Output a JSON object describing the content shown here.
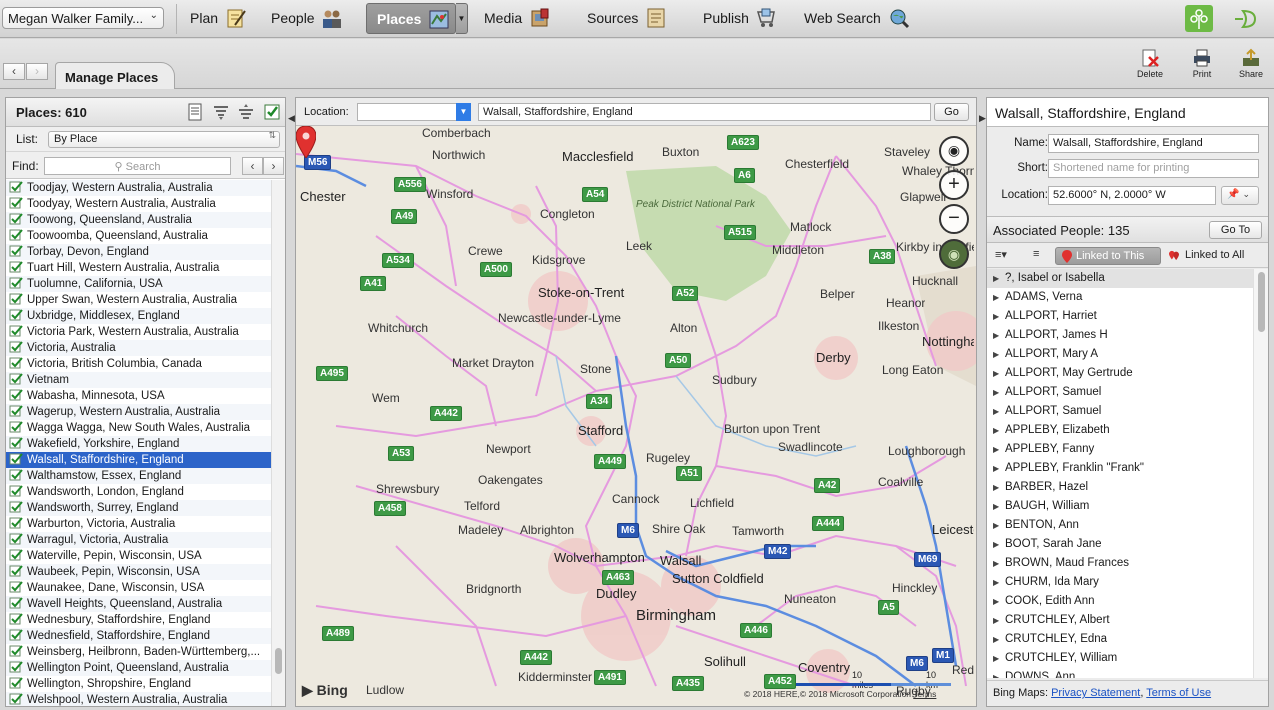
{
  "toolbar": {
    "family_file": "Megan Walker Family...",
    "nav": [
      {
        "id": "plan",
        "label": "Plan"
      },
      {
        "id": "people",
        "label": "People"
      },
      {
        "id": "places",
        "label": "Places"
      },
      {
        "id": "media",
        "label": "Media"
      },
      {
        "id": "sources",
        "label": "Sources"
      },
      {
        "id": "publish",
        "label": "Publish"
      },
      {
        "id": "web-search",
        "label": "Web Search"
      }
    ]
  },
  "subbar": {
    "tab": "Manage Places",
    "actions": {
      "delete": "Delete",
      "print": "Print",
      "share": "Share"
    }
  },
  "left": {
    "title": "Places: 610",
    "list_label": "List:",
    "list_value": "By Place",
    "find_label": "Find:",
    "search_placeholder": "Search",
    "places": [
      "Toodjay, Western Australia, Australia",
      "Toodyay, Western Australia, Australia",
      "Toowong, Queensland, Australia",
      "Toowoomba, Queensland, Australia",
      "Torbay, Devon, England",
      "Tuart Hill, Western Australia, Australia",
      "Tuolumne, California, USA",
      "Upper Swan, Western Australia, Australia",
      "Uxbridge, Middlesex, England",
      "Victoria Park, Western Australia, Australia",
      "Victoria, Australia",
      "Victoria, British Columbia, Canada",
      "Vietnam",
      "Wabasha, Minnesota, USA",
      "Wagerup, Western Australia, Australia",
      "Wagga Wagga, New South Wales, Australia",
      "Wakefield, Yorkshire, England",
      "Walsall, Staffordshire, England",
      "Walthamstow, Essex, England",
      "Wandsworth, London, England",
      "Wandsworth, Surrey, England",
      "Warburton, Victoria, Australia",
      "Warragul, Victoria, Australia",
      "Waterville, Pepin, Wisconsin, USA",
      "Waubeek, Pepin, Wisconsin, USA",
      "Waunakee, Dane, Wisconsin, USA",
      "Wavell Heights, Queensland, Australia",
      "Wednesbury, Staffordshire, England",
      "Wednesfield, Staffordshire, England",
      "Weinsberg, Heilbronn, Baden-Württemberg,...",
      "Wellington Point, Queensland, Australia",
      "Wellington, Shropshire, England",
      "Welshpool, Western Australia, Australia"
    ],
    "selected_index": 17
  },
  "map": {
    "location_label": "Location:",
    "location_value": "Walsall, Staffordshire, England",
    "go_label": "Go",
    "places": [
      "Comberbach",
      "Northwich",
      "Macclesfield",
      "Buxton",
      "Chesterfield",
      "Staveley",
      "Whaley Thorns",
      "Chester",
      "Winsford",
      "Congleton",
      "Peak District National Park",
      "Glapwell",
      "Crewe",
      "Leek",
      "Matlock",
      "Kidsgrove",
      "Middleton",
      "Kirkby in Ashfield",
      "Stoke-on-Trent",
      "Belper",
      "Heanor",
      "Hucknall",
      "Newcastle-under-Lyme",
      "Whitchurch",
      "Alton",
      "Ilkeston",
      "Nottingham",
      "Market Drayton",
      "Stone",
      "Derby",
      "Sudbury",
      "Long Eaton",
      "Wem",
      "Stafford",
      "Burton upon Trent",
      "Newport",
      "Rugeley",
      "Swadlincote",
      "Loughborough",
      "Shrewsbury",
      "Oakengates",
      "Coalville",
      "Cannock",
      "Lichfield",
      "Telford",
      "Madeley",
      "Albrighton",
      "Shire Oak",
      "Tamworth",
      "Leicester",
      "Wolverhampton",
      "Walsall",
      "Sutton Coldfield",
      "Dudley",
      "Hinckley",
      "Bridgnorth",
      "Birmingham",
      "Nuneaton",
      "Solihull",
      "Coventry",
      "Ludlow",
      "Kidderminster",
      "Redditch",
      "Rugby"
    ],
    "roads": [
      "M56",
      "A556",
      "A54",
      "A623",
      "A6",
      "A49",
      "A515",
      "A534",
      "A500",
      "A38",
      "A41",
      "A52",
      "A50",
      "A495",
      "A34",
      "A442",
      "A53",
      "A449",
      "A51",
      "A458",
      "M6",
      "A42",
      "A444",
      "M42",
      "M69",
      "A463",
      "A5",
      "A489",
      "A446",
      "A442",
      "A491",
      "A435",
      "A452",
      "M6",
      "M1"
    ],
    "attribution": "Bing",
    "scale_miles": "10 miles",
    "scale_km": "10 km",
    "copyright": "© 2018 HERE,© 2018 Microsoft Corporation",
    "terms": "Terms"
  },
  "right": {
    "title": "Walsall, Staffordshire, England",
    "name_label": "Name:",
    "name_value": "Walsall, Staffordshire, England",
    "short_label": "Short:",
    "short_placeholder": "Shortened name for printing",
    "location_label": "Location:",
    "location_value": "52.6000° N, 2.0000° W",
    "assoc_title": "Associated People:",
    "assoc_count": "135",
    "goto_label": "Go To",
    "linked_this": "Linked to This",
    "linked_all": "Linked to All",
    "people": [
      "?, Isabel or Isabella",
      "ADAMS, Verna",
      "ALLPORT, Harriet",
      "ALLPORT, James H",
      "ALLPORT, Mary A",
      "ALLPORT, May Gertrude",
      "ALLPORT, Samuel",
      "ALLPORT, Samuel",
      "APPLEBY, Elizabeth",
      "APPLEBY, Fanny",
      "APPLEBY, Franklin \"Frank\"",
      "BARBER, Hazel",
      "BAUGH, William",
      "BENTON, Ann",
      "BOOT, Sarah Jane",
      "BROWN, Maud Frances",
      "CHURM, Ida Mary",
      "COOK, Edith Ann",
      "CRUTCHLEY, Albert",
      "CRUTCHLEY, Edna",
      "CRUTCHLEY, William",
      "DOWNS, Ann"
    ],
    "bing_prefix": "Bing Maps:",
    "privacy_link": "Privacy Statement",
    "terms_link": "Terms of Use"
  },
  "colors": {
    "selection": "#2c64c9",
    "motorway": "#2b58b4",
    "primary_road": "#3e9a46",
    "link": "#1a52c4",
    "pin": "#e0312f"
  }
}
